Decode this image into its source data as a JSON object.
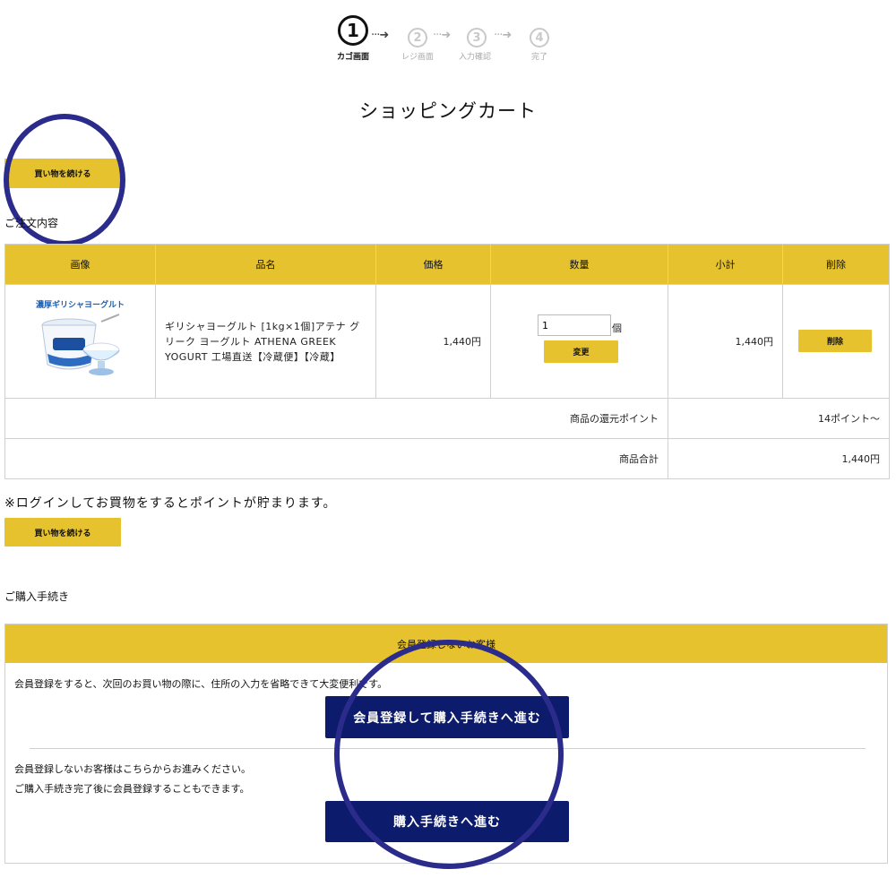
{
  "stepper": {
    "steps": [
      {
        "number": "1",
        "label": "カゴ画面"
      },
      {
        "number": "2",
        "label": "レジ画面"
      },
      {
        "number": "3",
        "label": "入力確認"
      },
      {
        "number": "4",
        "label": "完了"
      }
    ],
    "arrow": "···➜"
  },
  "page": {
    "title": "ショッピングカート"
  },
  "buttons": {
    "continue_shopping": "買い物を続ける",
    "change": "変更",
    "delete": "削除",
    "register_and_proceed": "会員登録して購入手続きへ進む",
    "proceed": "購入手続きへ進む"
  },
  "order_section": {
    "label": "ご注文内容"
  },
  "cart_table": {
    "headers": [
      "画像",
      "品名",
      "価格",
      "数量",
      "小計",
      "削除"
    ],
    "item": {
      "image_text": "濃厚ギリシャヨーグルト",
      "name": "ギリシャヨーグルト [1kg×1個]アテナ グリーク ヨーグルト ATHENA GREEK YOGURT 工場直送【冷蔵便】【冷蔵】",
      "price": "1,440円",
      "quantity": "1",
      "unit": "個",
      "subtotal": "1,440円"
    },
    "points_label": "商品の還元ポイント",
    "points_value": "14ポイント～",
    "total_label": "商品合計",
    "total_value": "1,440円"
  },
  "login_note": "※ログインしてお買物をするとポイントが貯まります。",
  "procedure": {
    "section_label": "ご購入手続き",
    "box_header": "会員登録しないお客様",
    "register_text": "会員登録をすると、次回のお買い物の際に、住所の入力を省略できて大変便利です。",
    "guest_text_1": "会員登録しないお客様はこちらからお進みください。",
    "guest_text_2": "ご購入手続き完了後に会員登録することもできます。"
  },
  "colors": {
    "accent_yellow": "#e6c22e",
    "navy": "#0c1b6b",
    "annotation": "#2b2b8c"
  }
}
